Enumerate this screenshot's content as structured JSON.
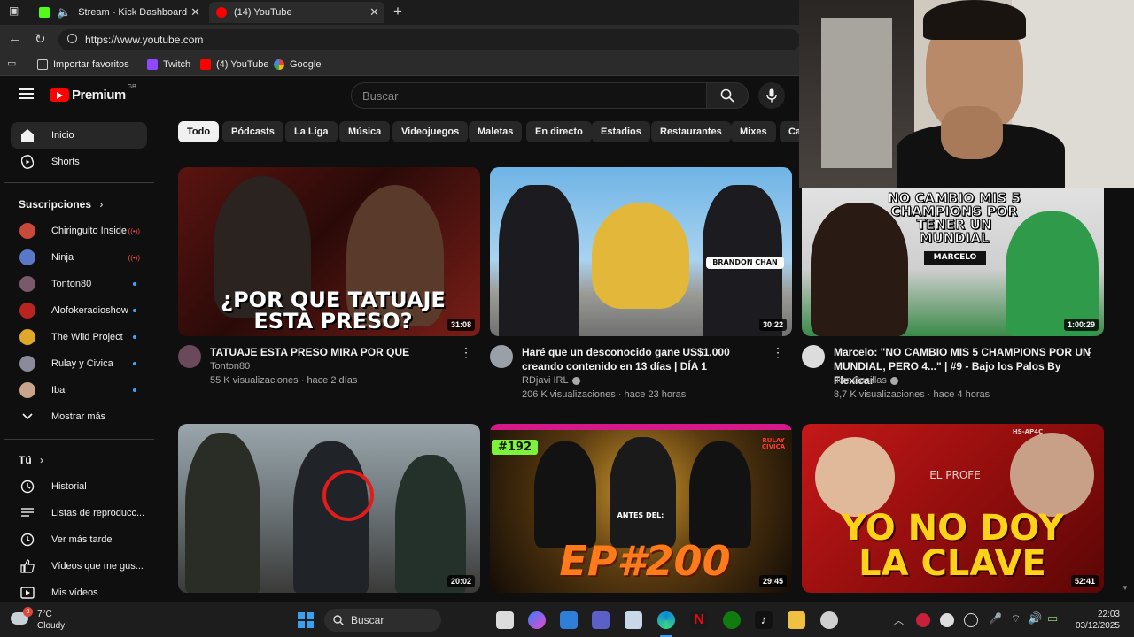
{
  "browser": {
    "tabs": [
      {
        "title": "Stream - Kick Dashboard",
        "icon": "kick-icon"
      },
      {
        "title": "(14) YouTube",
        "icon": "youtube-icon"
      }
    ],
    "url": "https://www.youtube.com",
    "favorites": [
      {
        "label": "Importar favoritos",
        "icon": "folder-icon"
      },
      {
        "label": "Twitch",
        "icon": "twitch-icon"
      },
      {
        "label": "(4) YouTube",
        "icon": "youtube-icon"
      },
      {
        "label": "Google",
        "icon": "google-icon"
      }
    ]
  },
  "youtube": {
    "logo_text": "Premium",
    "logo_region": "GB",
    "search_placeholder": "Buscar",
    "chips": [
      "Todo",
      "Pódcasts",
      "La Liga",
      "Música",
      "Videojuegos",
      "Maletas",
      "En directo",
      "Estadios",
      "Restaurantes",
      "Mixes",
      "Ca"
    ],
    "sidebar": {
      "main": [
        {
          "label": "Inicio",
          "icon": "home-icon"
        },
        {
          "label": "Shorts",
          "icon": "shorts-icon"
        }
      ],
      "subscriptions_title": "Suscripciones",
      "subscriptions": [
        {
          "label": "Chiringuito Inside",
          "status": "live",
          "color": "#c94a3a"
        },
        {
          "label": "Ninja",
          "status": "live",
          "color": "#5a78c8"
        },
        {
          "label": "Tonton80",
          "status": "new",
          "color": "#7a5a6a"
        },
        {
          "label": "Alofokeradioshow",
          "status": "new",
          "color": "#b8251f"
        },
        {
          "label": "The Wild Project",
          "status": "new",
          "color": "#e0a82a"
        },
        {
          "label": "Rulay y Civica",
          "status": "new",
          "color": "#8a8a9a"
        },
        {
          "label": "Ibai",
          "status": "new",
          "color": "#c8a48a"
        }
      ],
      "show_more": "Mostrar más",
      "you_title": "Tú",
      "you_items": [
        {
          "label": "Historial",
          "icon": "history-icon"
        },
        {
          "label": "Listas de reproducc...",
          "icon": "playlist-icon"
        },
        {
          "label": "Ver más tarde",
          "icon": "clock-icon"
        },
        {
          "label": "Vídeos que me gus...",
          "icon": "like-icon"
        },
        {
          "label": "Mis vídeos",
          "icon": "my-videos-icon"
        }
      ]
    },
    "videos": [
      {
        "title": "TATUAJE ESTA PRESO MIRA POR QUE",
        "channel": "Tonton80",
        "verified": false,
        "meta": "55 K visualizaciones · hace 2 días",
        "duration": "31:08",
        "thumb_text": "¿POR QUE TATUAJE ESTA PRESO?",
        "thumb_colors": [
          "#6a1a16",
          "#1a0a08"
        ]
      },
      {
        "title": "Haré que un desconocido gane US$1,000 creando contenido en 13 días | DÍA 1",
        "channel": "RDjavi IRL",
        "verified": true,
        "meta": "206 K visualizaciones · hace 23 horas",
        "duration": "30:22",
        "thumb_text": "BRANDON CHAN",
        "thumb_colors": [
          "#5fa7dc",
          "#e8c43a"
        ]
      },
      {
        "title": "Marcelo: \"NO CAMBIO MIS 5 CHAMPIONS POR UN MUNDIAL, PERO 4...\" | #9 - Bajo los Palos By Flexicar",
        "channel": "Iker Casillas",
        "verified": true,
        "meta": "8,7 K visualizaciones · hace 4 horas",
        "duration": "1:00:29",
        "thumb_text": "NO CAMBIO MIS 5 CHAMPIONS POR TENER UN MUNDIAL",
        "thumb_sub": "MARCELO",
        "thumb_colors": [
          "#d8d8d8",
          "#3a8a48"
        ]
      },
      {
        "title": "",
        "channel": "",
        "meta": "",
        "duration": "20:02",
        "thumb_text": "",
        "thumb_colors": [
          "#7a8890",
          "#3a3a38"
        ]
      },
      {
        "title": "",
        "channel": "",
        "meta": "",
        "duration": "29:45",
        "thumb_text": "EP#200",
        "thumb_badge": "#192",
        "thumb_sub": "ANTES DEL:",
        "thumb_brand": "RULAY CIVICA",
        "thumb_colors": [
          "#1a1208",
          "#b8860b"
        ]
      },
      {
        "title": "",
        "channel": "",
        "meta": "",
        "duration": "52:41",
        "thumb_text": "YO NO DOY LA CLAVE",
        "thumb_sub": "EL PROFE",
        "thumb_brand": "HS-AP4C",
        "thumb_colors": [
          "#b31515",
          "#6a0808"
        ]
      }
    ]
  },
  "taskbar": {
    "temperature": "7°C",
    "weather": "Cloudy",
    "weather_badge": "6",
    "search_label": "Buscar",
    "time": "22:03",
    "date": "03/12/2025"
  },
  "colors": {
    "background": "#0f0f0f",
    "youtube_red": "#ff0000",
    "chip_bg": "#272727",
    "text_secondary": "#aaaaaa",
    "accent_blue": "#3ea6ff"
  }
}
